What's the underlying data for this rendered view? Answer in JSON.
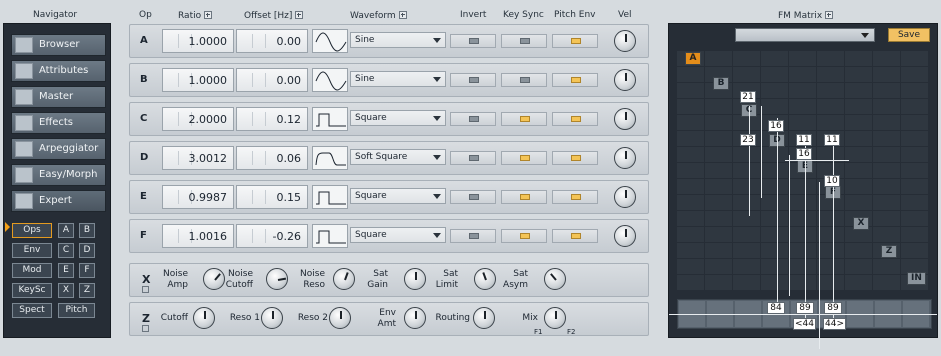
{
  "headers": {
    "navigator": "Navigator",
    "op": "Op",
    "ratio": "Ratio",
    "offset": "Offset [Hz]",
    "waveform": "Waveform",
    "invert": "Invert",
    "key_sync": "Key Sync",
    "pitch_env": "Pitch Env",
    "vel": "Vel",
    "fm_matrix": "FM Matrix"
  },
  "navigator": {
    "items": [
      {
        "label": "Browser",
        "icon": "browser-icon"
      },
      {
        "label": "Attributes",
        "icon": "attributes-icon"
      },
      {
        "label": "Master",
        "icon": "master-icon"
      },
      {
        "label": "Effects",
        "icon": "effects-icon"
      },
      {
        "label": "Arpeggiator",
        "icon": "arpeggiator-icon"
      },
      {
        "label": "Easy/Morph",
        "icon": "easy-morph-icon"
      },
      {
        "label": "Expert",
        "icon": "expert-icon",
        "active": true
      }
    ],
    "subpages": [
      [
        "Ops",
        "A",
        "B"
      ],
      [
        "Env",
        "C",
        "D"
      ],
      [
        "Mod",
        "E",
        "F"
      ],
      [
        "KeySc",
        "X",
        "Z"
      ],
      [
        "Spect",
        "Pitch"
      ]
    ],
    "active_subpage": "Ops"
  },
  "operators": [
    {
      "op": "A",
      "ratio": "1.0000",
      "offset": "0.00",
      "waveform": "Sine",
      "invert": false,
      "key_sync": false,
      "pitch_env": true
    },
    {
      "op": "B",
      "ratio": "1.0000",
      "offset": "0.00",
      "waveform": "Sine",
      "invert": false,
      "key_sync": false,
      "pitch_env": true
    },
    {
      "op": "C",
      "ratio": "2.0000",
      "offset": "0.12",
      "waveform": "Square",
      "invert": false,
      "key_sync": true,
      "pitch_env": true
    },
    {
      "op": "D",
      "ratio": "3.0012",
      "offset": "0.06",
      "waveform": "Soft Square",
      "invert": false,
      "key_sync": true,
      "pitch_env": true
    },
    {
      "op": "E",
      "ratio": "0.9987",
      "offset": "0.15",
      "waveform": "Square",
      "invert": false,
      "key_sync": true,
      "pitch_env": true
    },
    {
      "op": "F",
      "ratio": "1.0016",
      "offset": "-0.26",
      "waveform": "Square",
      "invert": false,
      "key_sync": true,
      "pitch_env": true
    }
  ],
  "x_section": {
    "label": "X",
    "params": [
      "Noise\nAmp",
      "Noise\nCutoff",
      "Noise\nReso",
      "Sat\nGain",
      "Sat\nLimit",
      "Sat\nAsym"
    ]
  },
  "z_section": {
    "label": "Z",
    "params": [
      "Cutoff",
      "Reso 1",
      "Reso 2",
      "Env\nAmt",
      "Routing",
      "Mix"
    ],
    "mix_f1": "F1",
    "mix_f2": "F2"
  },
  "fm_matrix": {
    "save_label": "Save",
    "preset": "",
    "ops": [
      "A",
      "B",
      "C",
      "D",
      "E",
      "F",
      "X",
      "Z",
      "IN"
    ],
    "values": {
      "c_top": "21",
      "c_side": "23",
      "d_top": "16",
      "d_right1": "11",
      "d_right2": "11",
      "e_top": "16",
      "f_top": "10",
      "out1": "84",
      "out2": "89",
      "out3": "89",
      "pan1": "<44",
      "pan2": "44>"
    }
  },
  "colors": {
    "accent": "#e48d1a",
    "toggle_on": "#f4c456",
    "panel_dark": "#262d36"
  }
}
